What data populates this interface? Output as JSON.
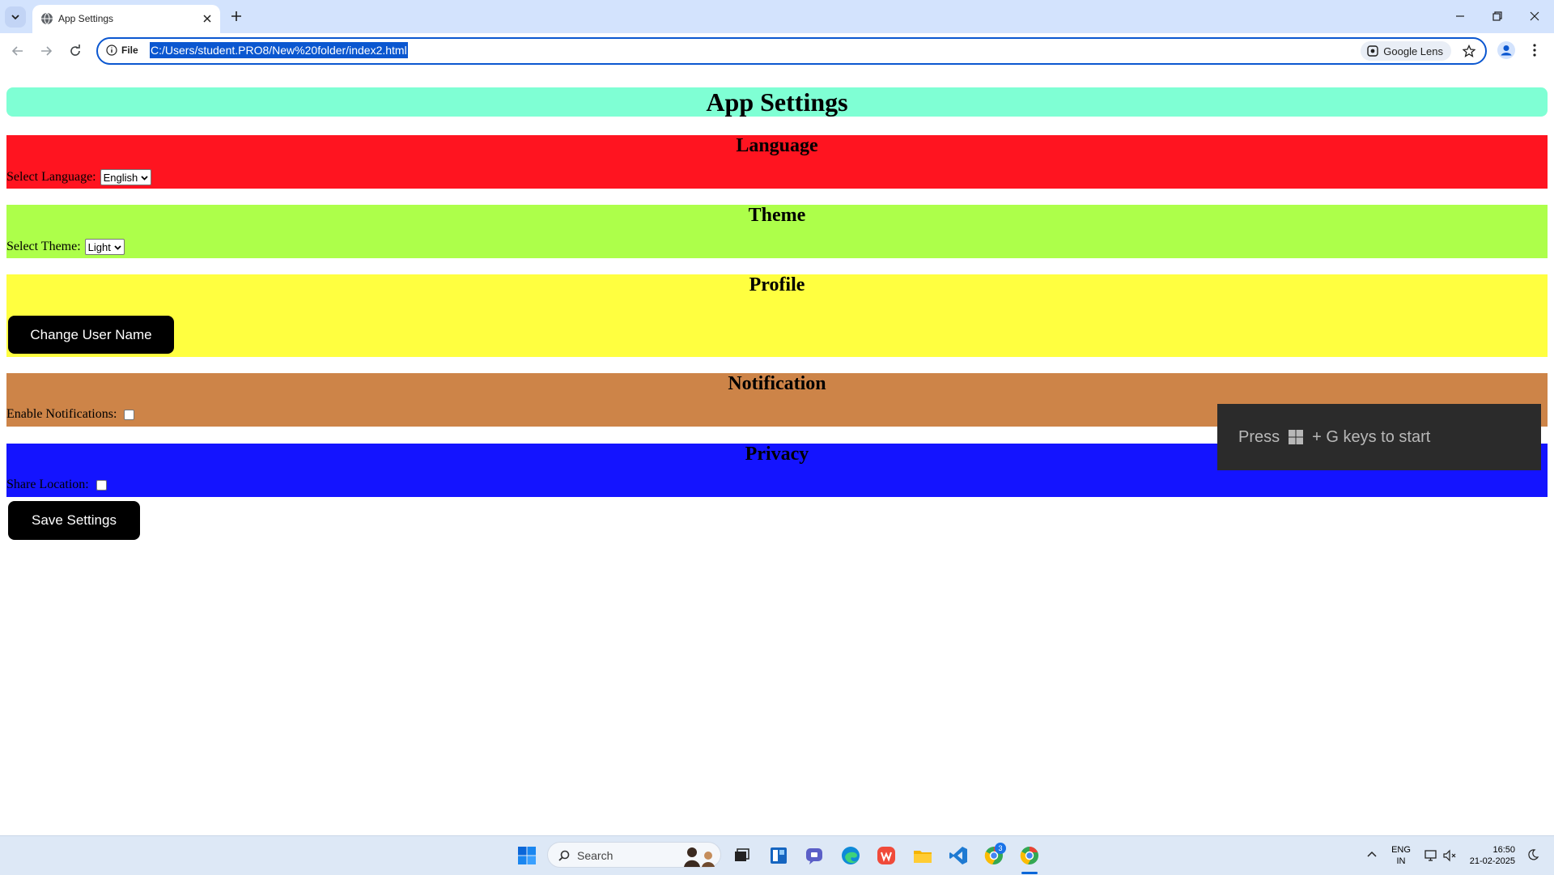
{
  "browser": {
    "tab_title": "App Settings",
    "site_chip": "File",
    "url": "C:/Users/student.PRO8/New%20folder/index2.html",
    "lens_label": "Google Lens"
  },
  "page": {
    "title": "App Settings",
    "sections": {
      "language": {
        "heading": "Language",
        "label": "Select Language:",
        "selected": "English",
        "color": "#ff1420"
      },
      "theme": {
        "heading": "Theme",
        "label": "Select Theme:",
        "selected": "Light",
        "color": "#adff4a"
      },
      "profile": {
        "heading": "Profile",
        "button": "Change User Name",
        "color": "#ffff40"
      },
      "notification": {
        "heading": "Notification",
        "label": "Enable Notifications:",
        "color": "#cd8448"
      },
      "privacy": {
        "heading": "Privacy",
        "label": "Share Location:",
        "color": "#1414ff"
      }
    },
    "save_button": "Save Settings",
    "title_bar_color": "#7fffd4"
  },
  "toast": {
    "prefix": "Press",
    "suffix": "+ G keys to start"
  },
  "taskbar": {
    "search_label": "Search",
    "lang_top": "ENG",
    "lang_bottom": "IN",
    "time": "16:50",
    "date": "21-02-2025",
    "badge": "3"
  }
}
